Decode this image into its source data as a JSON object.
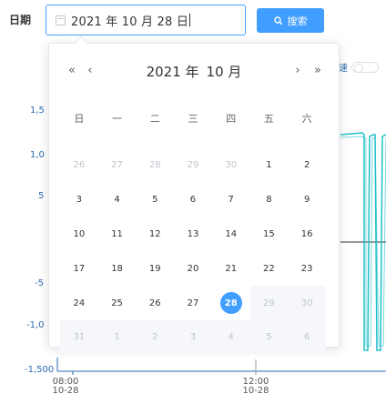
{
  "filter": {
    "date_label": "日期",
    "date_value": "2021 年 10 月 28 日",
    "search_label": "搜索"
  },
  "chart": {
    "yticks": [
      "1,5",
      "1,0",
      "5",
      "-5",
      "-1,0",
      "-1,500"
    ],
    "xticks": [
      {
        "time": "08:00",
        "date": "10-28"
      },
      {
        "time": "12:00",
        "date": "10-28"
      }
    ],
    "legend_fragment": "速",
    "colors": {
      "series": "#20c0c8",
      "axis": "#2d6ab0"
    }
  },
  "picker": {
    "year": "2021 年",
    "month": "10 月",
    "prev_year": "«",
    "prev_month": "‹",
    "next_month": "›",
    "next_year": "»",
    "weekdays": [
      "日",
      "一",
      "二",
      "三",
      "四",
      "五",
      "六"
    ],
    "days": [
      {
        "d": "26",
        "s": "other"
      },
      {
        "d": "27",
        "s": "other"
      },
      {
        "d": "28",
        "s": "other"
      },
      {
        "d": "29",
        "s": "other"
      },
      {
        "d": "30",
        "s": "other"
      },
      {
        "d": "1",
        "s": ""
      },
      {
        "d": "2",
        "s": ""
      },
      {
        "d": "3",
        "s": ""
      },
      {
        "d": "4",
        "s": ""
      },
      {
        "d": "5",
        "s": ""
      },
      {
        "d": "6",
        "s": ""
      },
      {
        "d": "7",
        "s": ""
      },
      {
        "d": "8",
        "s": ""
      },
      {
        "d": "9",
        "s": ""
      },
      {
        "d": "10",
        "s": ""
      },
      {
        "d": "11",
        "s": ""
      },
      {
        "d": "12",
        "s": ""
      },
      {
        "d": "13",
        "s": ""
      },
      {
        "d": "14",
        "s": ""
      },
      {
        "d": "15",
        "s": ""
      },
      {
        "d": "16",
        "s": ""
      },
      {
        "d": "17",
        "s": ""
      },
      {
        "d": "18",
        "s": ""
      },
      {
        "d": "19",
        "s": ""
      },
      {
        "d": "20",
        "s": ""
      },
      {
        "d": "21",
        "s": ""
      },
      {
        "d": "22",
        "s": ""
      },
      {
        "d": "23",
        "s": ""
      },
      {
        "d": "24",
        "s": ""
      },
      {
        "d": "25",
        "s": ""
      },
      {
        "d": "26",
        "s": ""
      },
      {
        "d": "27",
        "s": ""
      },
      {
        "d": "28",
        "s": "selected"
      },
      {
        "d": "29",
        "s": "disabled"
      },
      {
        "d": "30",
        "s": "disabled"
      },
      {
        "d": "31",
        "s": "disabled"
      },
      {
        "d": "1",
        "s": "disabled"
      },
      {
        "d": "2",
        "s": "disabled"
      },
      {
        "d": "3",
        "s": "disabled"
      },
      {
        "d": "4",
        "s": "disabled"
      },
      {
        "d": "5",
        "s": "disabled"
      },
      {
        "d": "6",
        "s": "disabled"
      }
    ],
    "accent": "#409eff"
  }
}
